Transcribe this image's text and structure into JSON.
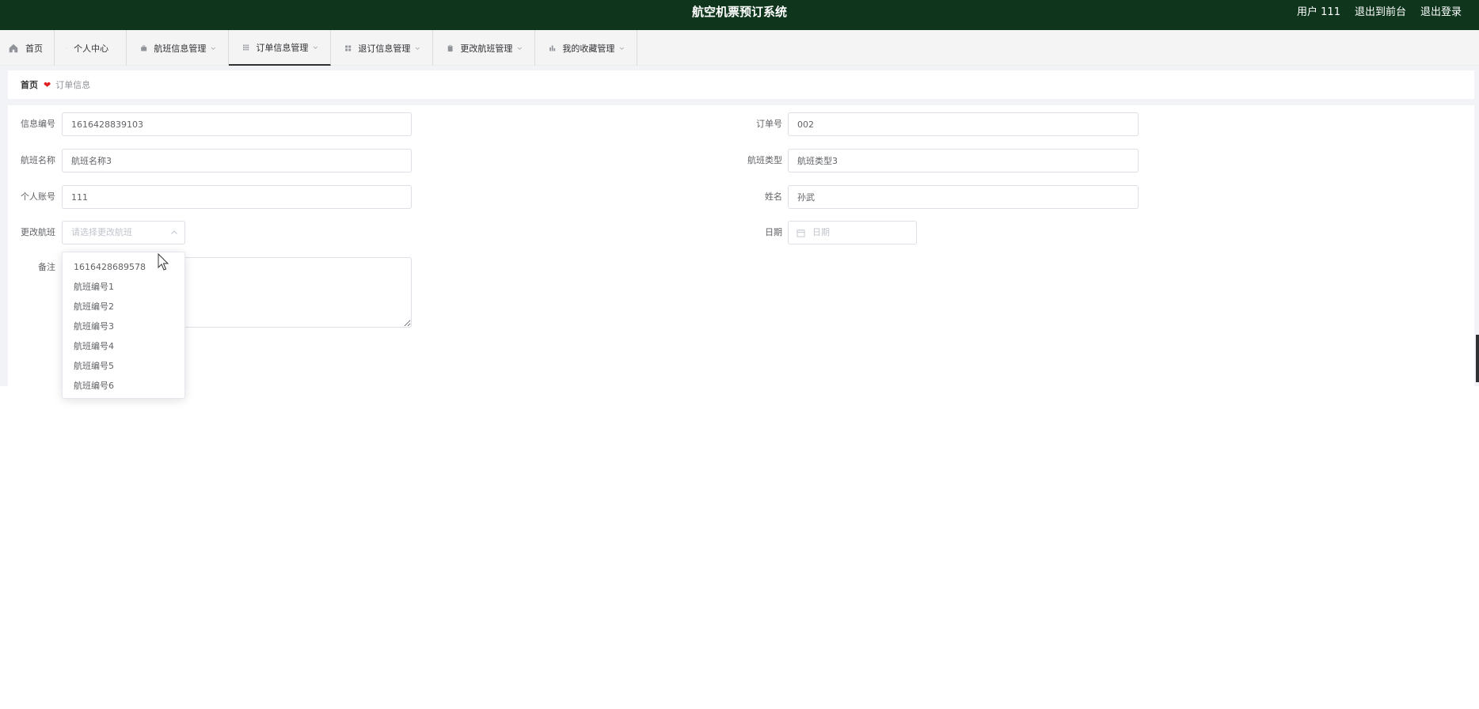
{
  "header": {
    "title": "航空机票预订系统",
    "user_label": "用户 111",
    "to_front_label": "退出到前台",
    "logout_label": "退出登录",
    "bg_color": "#0f361d"
  },
  "nav": {
    "items": [
      {
        "label": "首页",
        "icon": "home-icon"
      },
      {
        "label": "个人中心",
        "icon": "user-icon"
      },
      {
        "label": "航班信息管理",
        "icon": "briefcase-icon"
      },
      {
        "label": "订单信息管理",
        "icon": "grid-icon",
        "active": true
      },
      {
        "label": "退订信息管理",
        "icon": "apps-icon"
      },
      {
        "label": "更改航班管理",
        "icon": "clipboard-icon"
      },
      {
        "label": "我的收藏管理",
        "icon": "chart-icon"
      }
    ]
  },
  "breadcrumb": {
    "home": "首页",
    "current": "订单信息"
  },
  "form": {
    "info_no": {
      "label": "信息编号",
      "value": "1616428839103"
    },
    "order_no": {
      "label": "订单号",
      "value": "002"
    },
    "flight_name": {
      "label": "航班名称",
      "value": "航班名称3"
    },
    "flight_type": {
      "label": "航班类型",
      "value": "航班类型3"
    },
    "account": {
      "label": "个人账号",
      "value": "111"
    },
    "name": {
      "label": "姓名",
      "value": "孙武"
    },
    "change_flight": {
      "label": "更改航班",
      "placeholder": "请选择更改航班"
    },
    "date": {
      "label": "日期",
      "placeholder": "日期"
    },
    "remark": {
      "label": "备注",
      "value": ""
    }
  },
  "dropdown": {
    "options": [
      "1616428689578",
      "航班编号1",
      "航班编号2",
      "航班编号3",
      "航班编号4",
      "航班编号5",
      "航班编号6"
    ]
  }
}
